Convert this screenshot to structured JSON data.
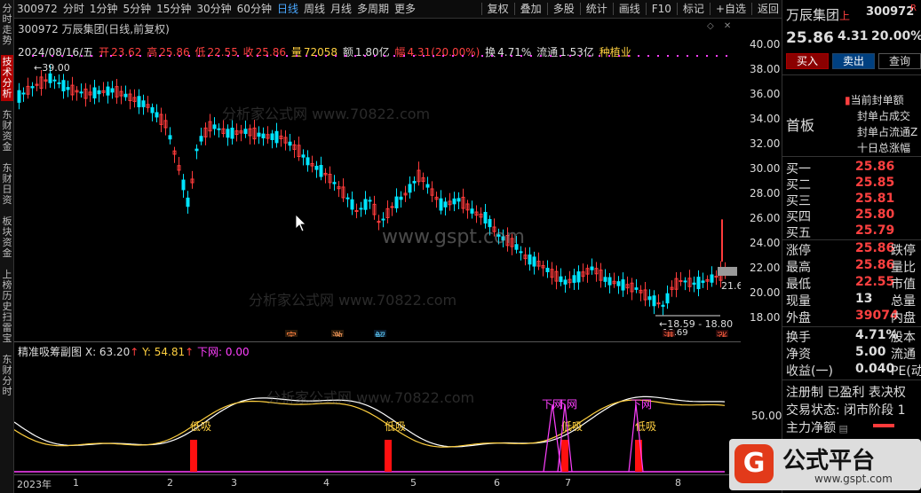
{
  "sidebar": [
    "分时走势",
    "技术分析",
    "东财资金",
    "东财日资",
    "板块资金",
    "上榜历史",
    "扫雷宝",
    "东财分时"
  ],
  "toolbar": {
    "code": "300972",
    "periods": [
      "分时",
      "1分钟",
      "5分钟",
      "15分钟",
      "30分钟",
      "60分钟",
      "日线",
      "周线",
      "月线",
      "多周期",
      "更多"
    ],
    "active_period": "日线",
    "tools": [
      "复权",
      "叠加",
      "多股",
      "统计",
      "画线",
      "F10",
      "标记",
      "+自选",
      "返回"
    ]
  },
  "info": {
    "title": "300972 万辰集团(日线,前复权)",
    "date": "2024/08/16/五",
    "open_label": "开",
    "open": "23.62",
    "high_label": "高",
    "high": "25.86",
    "low_label": "低",
    "low": "22.55",
    "close_label": "收",
    "close": "25.86",
    "vol_label": "量",
    "vol": "72058",
    "amount_label": "额",
    "amount": "1.80亿",
    "range_label": "幅",
    "range": "4.31(20.00%)",
    "turnover_label": "换",
    "turnover": "4.71%",
    "float_label": "流通",
    "float": "1.53亿",
    "sector": "种植业"
  },
  "annotations": {
    "high_mark": "39.00",
    "low_mark": "18.59 - 18.80",
    "low_mark2": "18.69",
    "last_price": "21.6",
    "events": [
      "定",
      "激",
      "解",
      "港",
      "涨"
    ]
  },
  "y_ticks": [
    "40.00",
    "38.00",
    "36.00",
    "34.00",
    "32.00",
    "30.00",
    "28.00",
    "26.00",
    "24.00",
    "22.00",
    "20.00",
    "18.00"
  ],
  "sub": {
    "name": "精准吸筹副图",
    "x": "X: 63.20",
    "y": "Y: 54.81",
    "down": "下网: 0.00",
    "y_tick": "50.00",
    "labels": [
      "低吸",
      "低吸",
      "低吸",
      "低吸",
      "下网",
      "下网",
      "下网"
    ]
  },
  "x_axis": [
    "2023年",
    "1",
    "2",
    "3",
    "4",
    "5",
    "6",
    "7",
    "8"
  ],
  "right": {
    "name": "万辰集团",
    "market": "上",
    "code": "300972",
    "flag": "R",
    "price": "25.86",
    "change": "4.31",
    "pct": "20.00%",
    "buy_btn": "买入",
    "sell_btn": "卖出",
    "query_btn": "查询",
    "board": "首板",
    "seal_items": [
      "当前封单额",
      "封单占成交",
      "封单占流通Z",
      "十日总涨幅"
    ],
    "bids": [
      {
        "label": "买一",
        "price": "25.86"
      },
      {
        "label": "买二",
        "price": "25.85"
      },
      {
        "label": "买三",
        "price": "25.81"
      },
      {
        "label": "买四",
        "price": "25.80"
      },
      {
        "label": "买五",
        "price": "25.79"
      }
    ],
    "stats": [
      {
        "label": "涨停",
        "value": "25.86",
        "label2": "跌停"
      },
      {
        "label": "最高",
        "value": "25.86",
        "label2": "量比"
      },
      {
        "label": "最低",
        "value": "22.55",
        "label2": "市值"
      },
      {
        "label": "现量",
        "value": "13",
        "label2": "总量"
      },
      {
        "label": "外盘",
        "value": "39074",
        "label2": "内盘"
      }
    ],
    "stats2": [
      {
        "label": "换手",
        "value": "4.71%",
        "label2": "股本"
      },
      {
        "label": "净资",
        "value": "5.00",
        "label2": "流通"
      },
      {
        "label": "收益(一)",
        "value": "0.040",
        "label2": "PE(动"
      }
    ],
    "reg": "注册制 已盈利 表决权",
    "trade_state": "交易状态: 闭市阶段 1",
    "main_net": "主力净额",
    "logo_text": "公式平台",
    "logo_url": "www.gspt.com"
  },
  "watermark": [
    "分析家公式网 www.70822.com",
    "www.gspt.com"
  ],
  "colors": {
    "up": "#ff3b3b",
    "down": "#00e5ff",
    "accent": "#ff4040",
    "yellow": "#ffd040",
    "magenta": "#ff40ff"
  }
}
